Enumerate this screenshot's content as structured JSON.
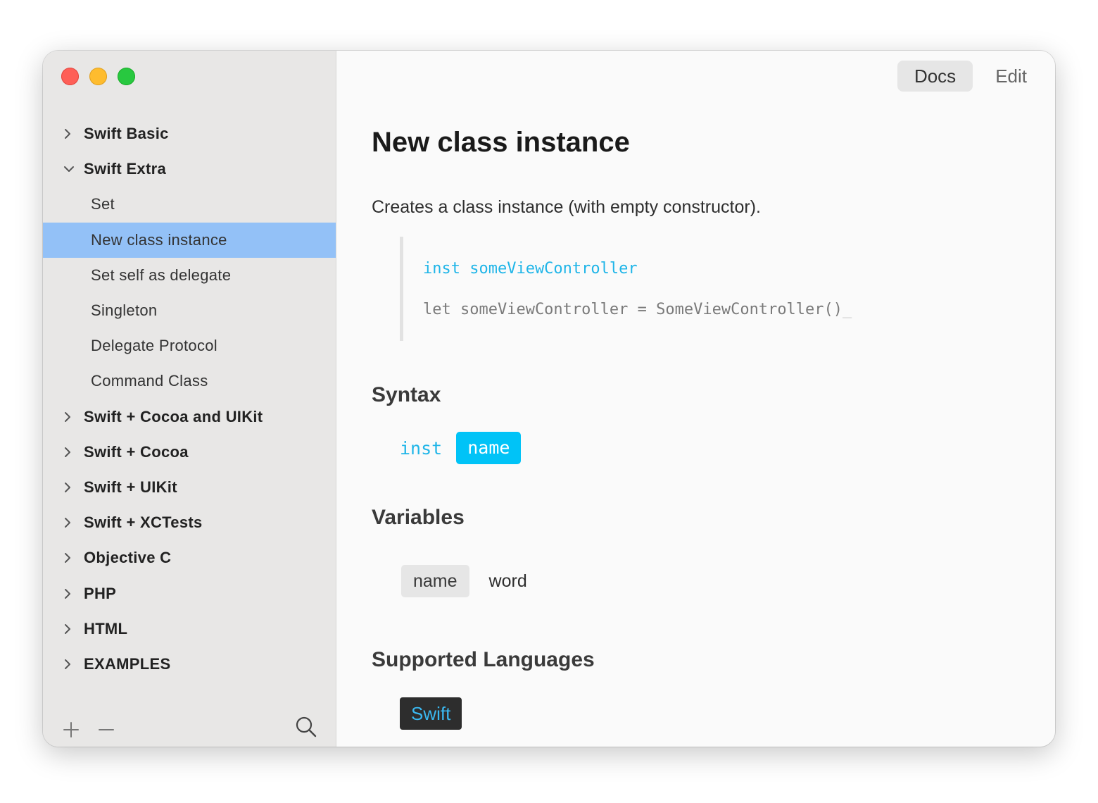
{
  "window": {
    "controls": [
      "close",
      "minimize",
      "zoom"
    ]
  },
  "sidebar": {
    "items": [
      {
        "label": "Swift Basic",
        "kind": "group",
        "expanded": false
      },
      {
        "label": "Swift Extra",
        "kind": "group",
        "expanded": true
      },
      {
        "label": "Set",
        "kind": "leaf"
      },
      {
        "label": "New class instance",
        "kind": "leaf",
        "selected": true
      },
      {
        "label": "Set self as delegate",
        "kind": "leaf"
      },
      {
        "label": "Singleton",
        "kind": "leaf"
      },
      {
        "label": "Delegate Protocol",
        "kind": "leaf"
      },
      {
        "label": "Command Class",
        "kind": "leaf"
      },
      {
        "label": "Swift + Cocoa and UIKit",
        "kind": "group",
        "expanded": false
      },
      {
        "label": "Swift + Cocoa",
        "kind": "group",
        "expanded": false
      },
      {
        "label": "Swift + UIKit",
        "kind": "group",
        "expanded": false
      },
      {
        "label": "Swift + XCTests",
        "kind": "group",
        "expanded": false
      },
      {
        "label": "Objective C",
        "kind": "group",
        "expanded": false
      },
      {
        "label": "PHP",
        "kind": "group",
        "expanded": false
      },
      {
        "label": "HTML",
        "kind": "group",
        "expanded": false
      },
      {
        "label": "EXAMPLES",
        "kind": "group",
        "expanded": false
      }
    ],
    "selection_color": "#93c1f7"
  },
  "toolbar": {
    "docs_label": "Docs",
    "edit_label": "Edit"
  },
  "doc": {
    "title": "New class instance",
    "description": "Creates a class instance (with empty constructor).",
    "example": {
      "trigger": "inst someViewController",
      "expansion": "let someViewController = SomeViewController()",
      "cursor": "_"
    },
    "syntax_heading": "Syntax",
    "syntax": {
      "keyword": "inst",
      "placeholder": "name"
    },
    "variables_heading": "Variables",
    "variables": [
      {
        "name": "name",
        "type": "word"
      }
    ],
    "languages_heading": "Supported Languages",
    "languages": [
      "Swift"
    ]
  },
  "colors": {
    "accent": "#00c3f7",
    "keyword": "#1fb5e8"
  }
}
